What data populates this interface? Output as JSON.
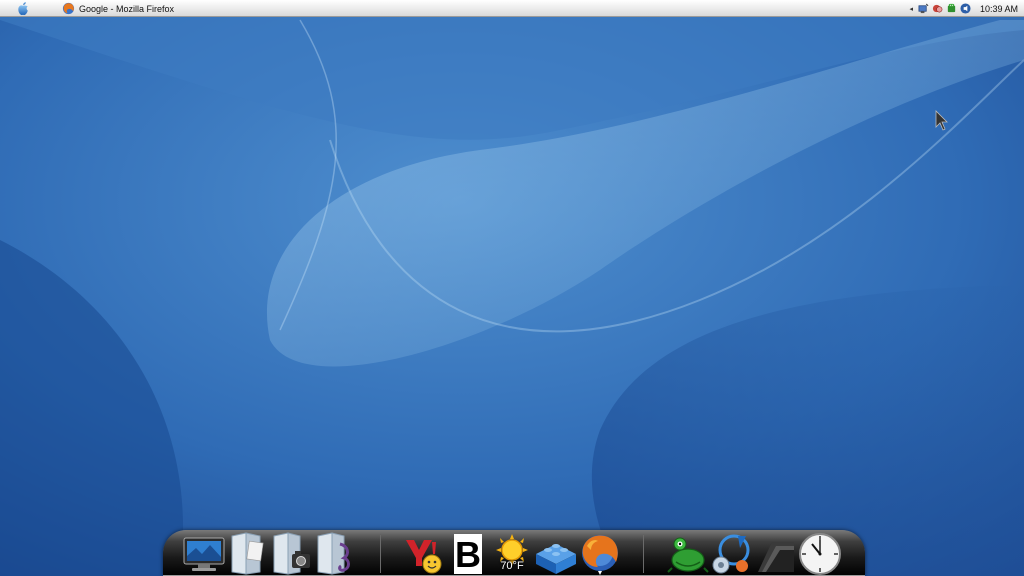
{
  "menubar": {
    "active_window_title": "Google - Mozilla Firefox",
    "clock": "10:39 AM",
    "tray_arrow": "◂"
  },
  "tray_icons": [
    "network-icon",
    "chat-icon",
    "android-icon",
    "speaker-icon"
  ],
  "dock": {
    "items": [
      {
        "name": "display-settings-icon"
      },
      {
        "name": "documents-folder-icon"
      },
      {
        "name": "pictures-folder-icon"
      },
      {
        "name": "music-folder-icon"
      },
      {
        "name": "yahoo-messenger-icon"
      },
      {
        "name": "bold-b-icon",
        "label": "B"
      },
      {
        "name": "weather-widget-icon",
        "temperature": "70°F"
      },
      {
        "name": "lego-brick-icon"
      },
      {
        "name": "firefox-icon"
      },
      {
        "name": "frog-app-icon"
      },
      {
        "name": "system-tools-icon"
      },
      {
        "name": "stack-icon"
      },
      {
        "name": "clock-icon"
      }
    ]
  },
  "colors": {
    "wallpaper_dark": "#1d4f97",
    "wallpaper_light": "#6aa6d8",
    "dock_black": "#000000",
    "menubar_bg": "#ececec"
  }
}
